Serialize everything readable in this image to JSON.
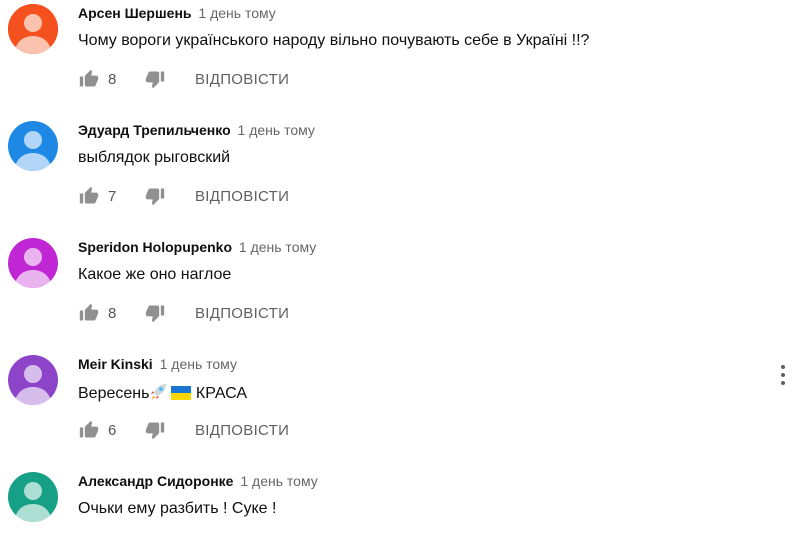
{
  "reply_label": "ВІДПОВІСТИ",
  "comments": [
    {
      "author": "Арсен Шершень",
      "time": "1 день тому",
      "text": "Чому вороги українського народу  вільно почувають себе в Україні !!?",
      "likes": "8",
      "avatar_color": "#f4511e"
    },
    {
      "author": "Эдуард Трепильченко",
      "time": "1 день тому",
      "text": "выблядок рыговский",
      "likes": "7",
      "avatar_color": "#1e88e5"
    },
    {
      "author": "Speridon Holopupenko",
      "time": "1 день тому",
      "text": "Какое  же оно наглое",
      "likes": "8",
      "avatar_color": "#c026d3"
    },
    {
      "author": "Meir Kinski",
      "time": "1 день тому",
      "text": "Вересень",
      "text_tail": "КРАСА",
      "emojis": [
        "rocket-icon",
        "ukraine-flag-icon"
      ],
      "likes": "6",
      "avatar_color": "#8e44c9"
    },
    {
      "author": "Александр Сидоронке",
      "time": "1 день тому",
      "text": "Очьки ему разбить ! Суке !",
      "likes": "",
      "avatar_color": "#16a085"
    }
  ]
}
